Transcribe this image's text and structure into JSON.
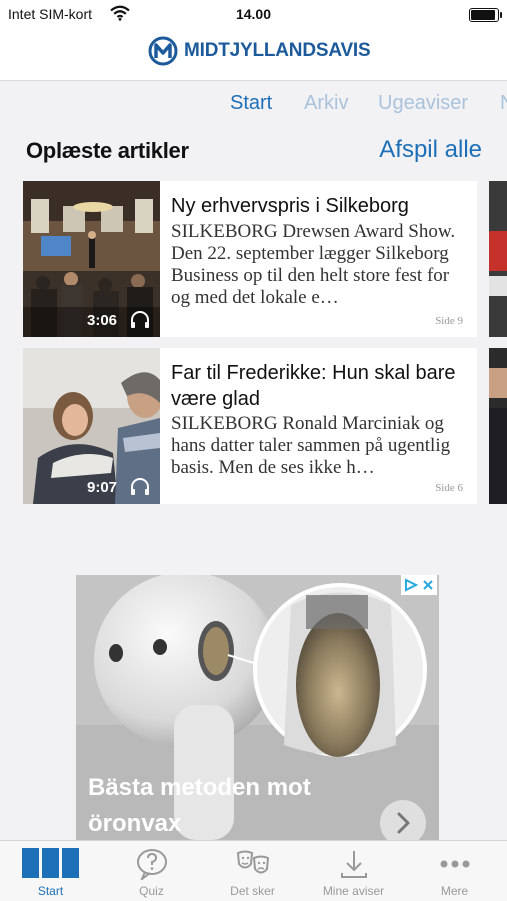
{
  "status": {
    "carrier": "Intet SIM-kort",
    "time": "14.00"
  },
  "header": {
    "brand_part1": "MIDTJYLLANDS",
    "brand_part2": "AVIS",
    "brand_color": "#1c5a9c"
  },
  "tabs": [
    {
      "label": "Start",
      "active": true
    },
    {
      "label": "Arkiv",
      "active": false
    },
    {
      "label": "Ugeaviser",
      "active": false
    },
    {
      "label": "N",
      "active": false
    }
  ],
  "section": {
    "title": "Oplæste artikler",
    "play_all": "Afspil alle"
  },
  "articles": [
    {
      "title": "Ny erhvervspris i Silkeborg",
      "body": "SILKEBORG Drewsen Award Show. Den 22. september lægger Silkeborg Business op til den helt store fest for og med det lokale e…",
      "page": "Side 9",
      "duration": "3:06"
    },
    {
      "title": "Far til Frederikke: Hun skal bare være glad",
      "body": "SILKEBORG Ronald Marciniak og hans datter taler sammen på ugentlig basis. Men de ses ikke h…",
      "page": "Side 6",
      "duration": "9:07"
    }
  ],
  "ad": {
    "text": "Bästa metoden mot öronvax"
  },
  "tabbar": [
    {
      "label": "Start",
      "icon": "newspaper-icon",
      "active": true
    },
    {
      "label": "Quiz",
      "icon": "quiz-bubble-icon",
      "active": false
    },
    {
      "label": "Det sker",
      "icon": "theater-masks-icon",
      "active": false
    },
    {
      "label": "Mine aviser",
      "icon": "download-icon",
      "active": false
    },
    {
      "label": "Mere",
      "icon": "more-dots-icon",
      "active": false
    }
  ],
  "colors": {
    "accent": "#1d6fb8",
    "inactive_tab": "#aac3dc",
    "background": "#f2f2f4"
  }
}
